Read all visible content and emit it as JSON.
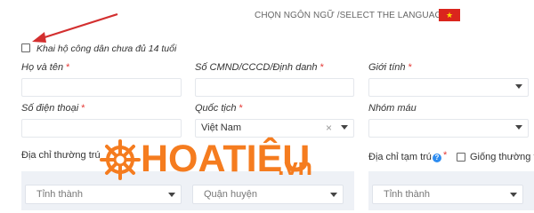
{
  "language": {
    "label": "CHỌN NGÔN NGỮ /SELECT THE LANGUAGE:",
    "flag_icon": "vietnam-flag",
    "flag_color": "#da251d",
    "star_color": "#ffde00"
  },
  "minor_checkbox": {
    "label": "Khai hộ công dân chưa đủ 14 tuổi",
    "checked": false
  },
  "fields": {
    "full_name": {
      "label": "Họ và tên",
      "value": ""
    },
    "id_number": {
      "label": "Số CMND/CCCD/Định danh",
      "value": ""
    },
    "gender": {
      "label": "Giới tính",
      "value": ""
    },
    "phone": {
      "label": "Số điện thoại",
      "value": ""
    },
    "nationality": {
      "label": "Quốc tịch",
      "value": "Việt Nam"
    },
    "blood_type": {
      "label": "Nhóm máu",
      "value": ""
    }
  },
  "required_mark": "*",
  "permanent_address": {
    "label": "Địa chỉ thường trú",
    "province_placeholder": "Tỉnh thành",
    "district_placeholder": "Quận huyện"
  },
  "temporary_address": {
    "label": "Địa chỉ tạm trú",
    "help_icon": "question-icon",
    "same_as_label": "Giống thường trú",
    "province_placeholder": "Tỉnh thành"
  },
  "watermark": {
    "brand": "HOATIÊU",
    "tld": ".vn",
    "color": "#f57c1f"
  },
  "annotation": {
    "color": "#d32f2f"
  }
}
